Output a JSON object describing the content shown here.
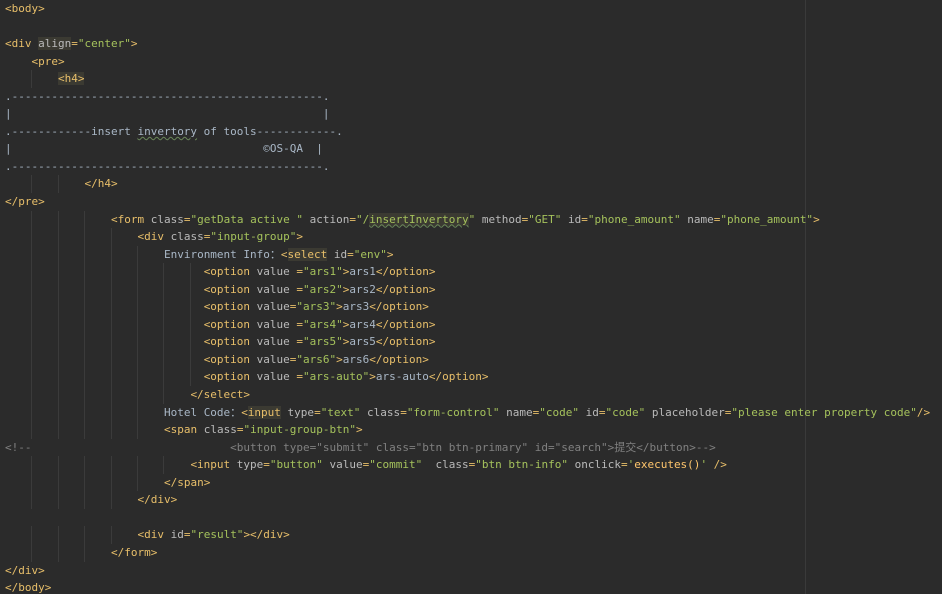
{
  "editor": {
    "language": "HTML",
    "theme": "dark",
    "colors": {
      "background": "#2b2b2b",
      "tag": "#e8bf6a",
      "attribute": "#bababa",
      "string": "#a5c25c",
      "text": "#a9b7c6",
      "comment": "#808080"
    },
    "lines": [
      {
        "indent": 0,
        "tokens": [
          {
            "t": "tag",
            "v": "<body>"
          }
        ]
      },
      {
        "indent": 0,
        "tokens": []
      },
      {
        "indent": 0,
        "tokens": [
          {
            "t": "tag",
            "v": "<div "
          },
          {
            "t": "attr",
            "v": "align",
            "hl": true
          },
          {
            "t": "tag",
            "v": "="
          },
          {
            "t": "val",
            "v": "\"center\""
          },
          {
            "t": "tag",
            "v": ">"
          }
        ]
      },
      {
        "indent": 4,
        "tokens": [
          {
            "t": "tag",
            "v": "<pre>"
          }
        ]
      },
      {
        "indent": 8,
        "tokens": [
          {
            "t": "tag",
            "v": "<h4>",
            "hl": true
          }
        ]
      },
      {
        "indent": 0,
        "tokens": [
          {
            "t": "txt",
            "v": ".-----------------------------------------------."
          }
        ]
      },
      {
        "indent": 0,
        "tokens": [
          {
            "t": "txt",
            "v": "|                                               |"
          }
        ]
      },
      {
        "indent": 0,
        "tokens": [
          {
            "t": "txt",
            "v": ".------------insert "
          },
          {
            "t": "txt",
            "v": "invertory",
            "spell": true
          },
          {
            "t": "txt",
            "v": " of tools------------."
          }
        ]
      },
      {
        "indent": 0,
        "tokens": [
          {
            "t": "txt",
            "v": "|                                      ©OS-QA  |"
          }
        ]
      },
      {
        "indent": 0,
        "tokens": [
          {
            "t": "txt",
            "v": ".-----------------------------------------------."
          }
        ]
      },
      {
        "indent": 12,
        "tokens": [
          {
            "t": "tag",
            "v": "</h4>"
          }
        ]
      },
      {
        "indent": 0,
        "tokens": [
          {
            "t": "tag",
            "v": "</pre>"
          }
        ]
      },
      {
        "indent": 16,
        "tokens": [
          {
            "t": "tag",
            "v": "<form "
          },
          {
            "t": "attr",
            "v": "class"
          },
          {
            "t": "tag",
            "v": "="
          },
          {
            "t": "val",
            "v": "\"getData active \""
          },
          {
            "t": "attr",
            "v": " action"
          },
          {
            "t": "tag",
            "v": "="
          },
          {
            "t": "val",
            "v": "\"/"
          },
          {
            "t": "val",
            "v": "insertInvertory",
            "hl": true,
            "spell": true
          },
          {
            "t": "val",
            "v": "\""
          },
          {
            "t": "attr",
            "v": " method"
          },
          {
            "t": "tag",
            "v": "="
          },
          {
            "t": "val",
            "v": "\"GET\""
          },
          {
            "t": "attr",
            "v": " id"
          },
          {
            "t": "tag",
            "v": "="
          },
          {
            "t": "val",
            "v": "\"phone_amount\""
          },
          {
            "t": "attr",
            "v": " name"
          },
          {
            "t": "tag",
            "v": "="
          },
          {
            "t": "val",
            "v": "\"phone_amount\""
          },
          {
            "t": "tag",
            "v": ">"
          }
        ]
      },
      {
        "indent": 20,
        "tokens": [
          {
            "t": "tag",
            "v": "<div "
          },
          {
            "t": "attr",
            "v": "class"
          },
          {
            "t": "tag",
            "v": "="
          },
          {
            "t": "val",
            "v": "\"input-group\""
          },
          {
            "t": "tag",
            "v": ">"
          }
        ]
      },
      {
        "indent": 24,
        "tokens": [
          {
            "t": "txt",
            "v": "Environment Info："
          },
          {
            "t": "tag",
            "v": "<"
          },
          {
            "t": "tag",
            "v": "select",
            "hl": true
          },
          {
            "t": "attr",
            "v": " id"
          },
          {
            "t": "tag",
            "v": "="
          },
          {
            "t": "val",
            "v": "\"env\""
          },
          {
            "t": "tag",
            "v": ">"
          }
        ]
      },
      {
        "indent": 30,
        "tokens": [
          {
            "t": "tag",
            "v": "<option "
          },
          {
            "t": "attr",
            "v": "value "
          },
          {
            "t": "tag",
            "v": "="
          },
          {
            "t": "val",
            "v": "\"ars1\""
          },
          {
            "t": "tag",
            "v": ">"
          },
          {
            "t": "txt",
            "v": "ars1"
          },
          {
            "t": "tag",
            "v": "</option>"
          }
        ]
      },
      {
        "indent": 30,
        "tokens": [
          {
            "t": "tag",
            "v": "<option "
          },
          {
            "t": "attr",
            "v": "value "
          },
          {
            "t": "tag",
            "v": "="
          },
          {
            "t": "val",
            "v": "\"ars2\""
          },
          {
            "t": "tag",
            "v": ">"
          },
          {
            "t": "txt",
            "v": "ars2"
          },
          {
            "t": "tag",
            "v": "</option>"
          }
        ]
      },
      {
        "indent": 30,
        "tokens": [
          {
            "t": "tag",
            "v": "<option "
          },
          {
            "t": "attr",
            "v": "value"
          },
          {
            "t": "tag",
            "v": "="
          },
          {
            "t": "val",
            "v": "\"ars3\""
          },
          {
            "t": "tag",
            "v": ">"
          },
          {
            "t": "txt",
            "v": "ars3"
          },
          {
            "t": "tag",
            "v": "</option>"
          }
        ]
      },
      {
        "indent": 30,
        "tokens": [
          {
            "t": "tag",
            "v": "<option "
          },
          {
            "t": "attr",
            "v": "value "
          },
          {
            "t": "tag",
            "v": "="
          },
          {
            "t": "val",
            "v": "\"ars4\""
          },
          {
            "t": "tag",
            "v": ">"
          },
          {
            "t": "txt",
            "v": "ars4"
          },
          {
            "t": "tag",
            "v": "</option>"
          }
        ]
      },
      {
        "indent": 30,
        "tokens": [
          {
            "t": "tag",
            "v": "<option "
          },
          {
            "t": "attr",
            "v": "value "
          },
          {
            "t": "tag",
            "v": "="
          },
          {
            "t": "val",
            "v": "\"ars5\""
          },
          {
            "t": "tag",
            "v": ">"
          },
          {
            "t": "txt",
            "v": "ars5"
          },
          {
            "t": "tag",
            "v": "</option>"
          }
        ]
      },
      {
        "indent": 30,
        "tokens": [
          {
            "t": "tag",
            "v": "<option "
          },
          {
            "t": "attr",
            "v": "value"
          },
          {
            "t": "tag",
            "v": "="
          },
          {
            "t": "val",
            "v": "\"ars6\""
          },
          {
            "t": "tag",
            "v": ">"
          },
          {
            "t": "txt",
            "v": "ars6"
          },
          {
            "t": "tag",
            "v": "</option>"
          }
        ]
      },
      {
        "indent": 30,
        "tokens": [
          {
            "t": "tag",
            "v": "<option "
          },
          {
            "t": "attr",
            "v": "value "
          },
          {
            "t": "tag",
            "v": "="
          },
          {
            "t": "val",
            "v": "\"ars-auto\""
          },
          {
            "t": "tag",
            "v": ">"
          },
          {
            "t": "txt",
            "v": "ars-auto"
          },
          {
            "t": "tag",
            "v": "</option>"
          }
        ]
      },
      {
        "indent": 28,
        "tokens": [
          {
            "t": "tag",
            "v": "</select>"
          }
        ]
      },
      {
        "indent": 24,
        "tokens": [
          {
            "t": "txt",
            "v": "Hotel Code："
          },
          {
            "t": "tag",
            "v": "<"
          },
          {
            "t": "tag",
            "v": "input",
            "hl": true
          },
          {
            "t": "attr",
            "v": " type"
          },
          {
            "t": "tag",
            "v": "="
          },
          {
            "t": "val",
            "v": "\"text\""
          },
          {
            "t": "attr",
            "v": " class"
          },
          {
            "t": "tag",
            "v": "="
          },
          {
            "t": "val",
            "v": "\"form-control\""
          },
          {
            "t": "attr",
            "v": " name"
          },
          {
            "t": "tag",
            "v": "="
          },
          {
            "t": "val",
            "v": "\"code\""
          },
          {
            "t": "attr",
            "v": " id"
          },
          {
            "t": "tag",
            "v": "="
          },
          {
            "t": "val",
            "v": "\"code\""
          },
          {
            "t": "attr",
            "v": " placeholder"
          },
          {
            "t": "tag",
            "v": "="
          },
          {
            "t": "val",
            "v": "\"please enter property code\""
          },
          {
            "t": "tag",
            "v": "/>"
          }
        ]
      },
      {
        "indent": 24,
        "tokens": [
          {
            "t": "tag",
            "v": "<span "
          },
          {
            "t": "attr",
            "v": "class"
          },
          {
            "t": "tag",
            "v": "="
          },
          {
            "t": "val",
            "v": "\"input-group-btn\""
          },
          {
            "t": "tag",
            "v": ">"
          }
        ]
      },
      {
        "indent": 0,
        "tokens": [
          {
            "t": "cmt",
            "v": "<!--                              <button type=\"submit\" class=\"btn btn-primary\" id=\"search\">提交</button>-->"
          }
        ]
      },
      {
        "indent": 28,
        "tokens": [
          {
            "t": "tag",
            "v": "<input "
          },
          {
            "t": "attr",
            "v": "type"
          },
          {
            "t": "tag",
            "v": "="
          },
          {
            "t": "val",
            "v": "\"button\""
          },
          {
            "t": "attr",
            "v": " value"
          },
          {
            "t": "tag",
            "v": "="
          },
          {
            "t": "val",
            "v": "\"commit\""
          },
          {
            "t": "attr",
            "v": "  class"
          },
          {
            "t": "tag",
            "v": "="
          },
          {
            "t": "val",
            "v": "\"btn btn-info\""
          },
          {
            "t": "attr",
            "v": " onclick"
          },
          {
            "t": "tag",
            "v": "="
          },
          {
            "t": "val",
            "v": "'"
          },
          {
            "t": "txt",
            "v": "executes()"
          },
          {
            "t": "val",
            "v": "'"
          },
          {
            "t": "tag",
            "v": " />"
          }
        ]
      },
      {
        "indent": 24,
        "tokens": [
          {
            "t": "tag",
            "v": "</span>"
          }
        ]
      },
      {
        "indent": 20,
        "tokens": [
          {
            "t": "tag",
            "v": "</div>"
          }
        ]
      },
      {
        "indent": 0,
        "tokens": []
      },
      {
        "indent": 20,
        "tokens": [
          {
            "t": "tag",
            "v": "<div "
          },
          {
            "t": "attr",
            "v": "id"
          },
          {
            "t": "tag",
            "v": "="
          },
          {
            "t": "val",
            "v": "\"result\""
          },
          {
            "t": "tag",
            "v": "></div>"
          }
        ]
      },
      {
        "indent": 16,
        "tokens": [
          {
            "t": "tag",
            "v": "</form>"
          }
        ]
      },
      {
        "indent": 0,
        "tokens": [
          {
            "t": "tag",
            "v": "</div>"
          }
        ]
      },
      {
        "indent": 0,
        "tokens": [
          {
            "t": "tag",
            "v": "</body>"
          }
        ]
      }
    ]
  }
}
